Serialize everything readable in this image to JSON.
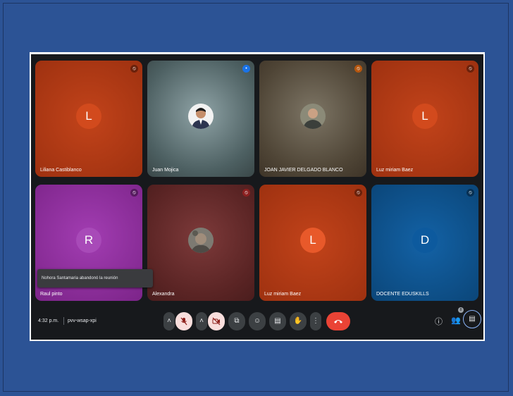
{
  "colors": {
    "background": "#2c5395",
    "meeting_bg": "#17191c",
    "tile_orange": "#b5380f",
    "tile_purple": "#8e2f9b",
    "tile_blue": "#0c4f8a",
    "leave_red": "#ea4335"
  },
  "participants": [
    {
      "name": "Liliana Castiblanco",
      "avatar_letter": "L",
      "type": "letter"
    },
    {
      "name": "Juan Mojica",
      "avatar_letter": "",
      "type": "photo"
    },
    {
      "name": "JOAN JAVIER DELGADO BLANCO",
      "avatar_letter": "",
      "type": "photo"
    },
    {
      "name": "Luz miriam Baez",
      "avatar_letter": "L",
      "type": "letter"
    },
    {
      "name": "Raul pinto",
      "avatar_letter": "R",
      "type": "letter"
    },
    {
      "name": "Alexandra",
      "avatar_letter": "",
      "type": "photo"
    },
    {
      "name": "Luz miriam Baez",
      "avatar_letter": "L",
      "type": "letter"
    },
    {
      "name": "DOCENTE EDUSKILLS",
      "avatar_letter": "D",
      "type": "letter"
    }
  ],
  "toast": "Nohora Santamaria abandonó la reunión",
  "bottom_bar": {
    "time": "4:32 p.m.",
    "meeting_code": "pvv-wsap-xpi",
    "participant_count": "8"
  },
  "icons": {
    "mic_off": "mic-off-icon",
    "camera_off": "camera-off-icon",
    "present": "present-icon",
    "emoji": "emoji-icon",
    "captions": "captions-icon",
    "hand": "raise-hand-icon",
    "more": "more-options-icon",
    "leave": "leave-call-icon",
    "info": "info-icon",
    "people": "people-icon",
    "chat": "chat-icon"
  }
}
